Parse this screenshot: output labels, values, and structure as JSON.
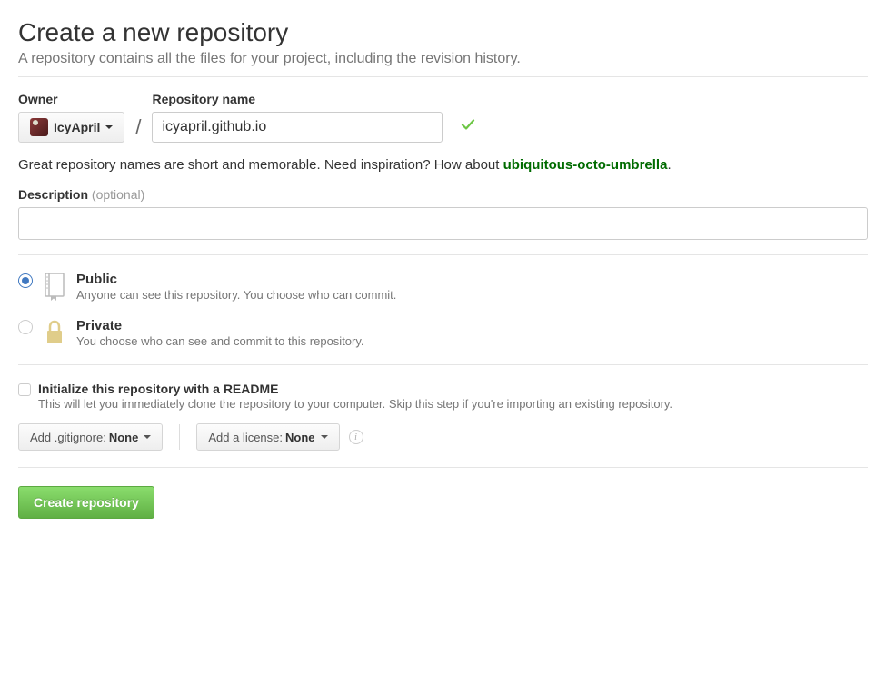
{
  "header": {
    "title": "Create a new repository",
    "subtitle": "A repository contains all the files for your project, including the revision history."
  },
  "owner": {
    "label": "Owner",
    "username": "IcyApril"
  },
  "repo": {
    "label": "Repository name",
    "value": "icyapril.github.io"
  },
  "name_hint": {
    "prefix": "Great repository names are short and memorable. Need inspiration? How about ",
    "suggestion": "ubiquitous-octo-umbrella",
    "suffix": "."
  },
  "description": {
    "label": "Description ",
    "optional": "(optional)"
  },
  "visibility": {
    "public": {
      "title": "Public",
      "desc": "Anyone can see this repository. You choose who can commit.",
      "selected": true
    },
    "private": {
      "title": "Private",
      "desc": "You choose who can see and commit to this repository.",
      "selected": false
    }
  },
  "readme": {
    "title": "Initialize this repository with a README",
    "desc": "This will let you immediately clone the repository to your computer. Skip this step if you're importing an existing repository."
  },
  "gitignore": {
    "label": "Add .gitignore: ",
    "value": "None"
  },
  "license": {
    "label": "Add a license: ",
    "value": "None"
  },
  "submit": {
    "label": "Create repository"
  }
}
